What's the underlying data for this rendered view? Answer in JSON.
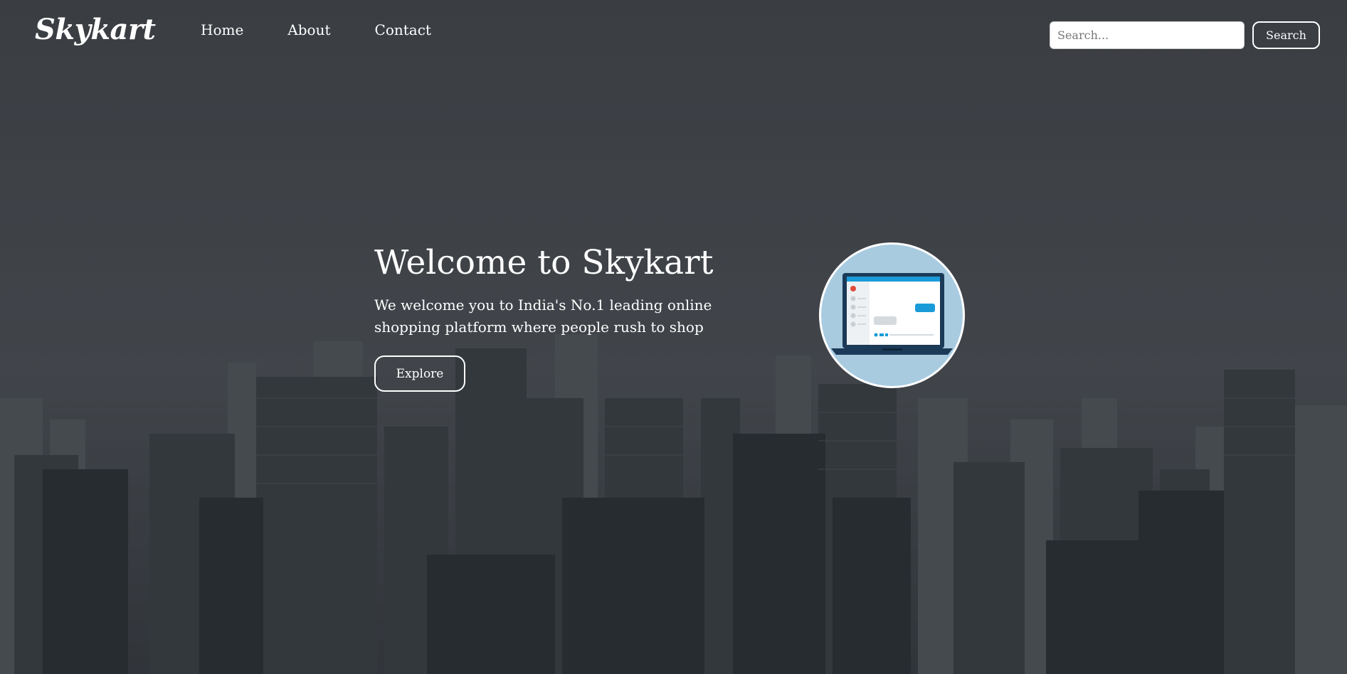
{
  "brand": {
    "name": "Skykart"
  },
  "nav": {
    "items": [
      {
        "label": "Home"
      },
      {
        "label": "About"
      },
      {
        "label": "Contact"
      }
    ]
  },
  "search": {
    "placeholder": "Search...",
    "button_label": "Search"
  },
  "hero": {
    "title": "Welcome to Skykart",
    "text": "We welcome you to India's No.1 leading online shopping platform where people rush to shop",
    "button_label": "Explore",
    "image_icon": "laptop-illustration"
  },
  "colors": {
    "text": "#ffffff",
    "background": "#4a4d50",
    "illustration_bg": "#a8cbe0",
    "laptop_blue": "#1a9bd8",
    "laptop_dark": "#1b3a57"
  }
}
